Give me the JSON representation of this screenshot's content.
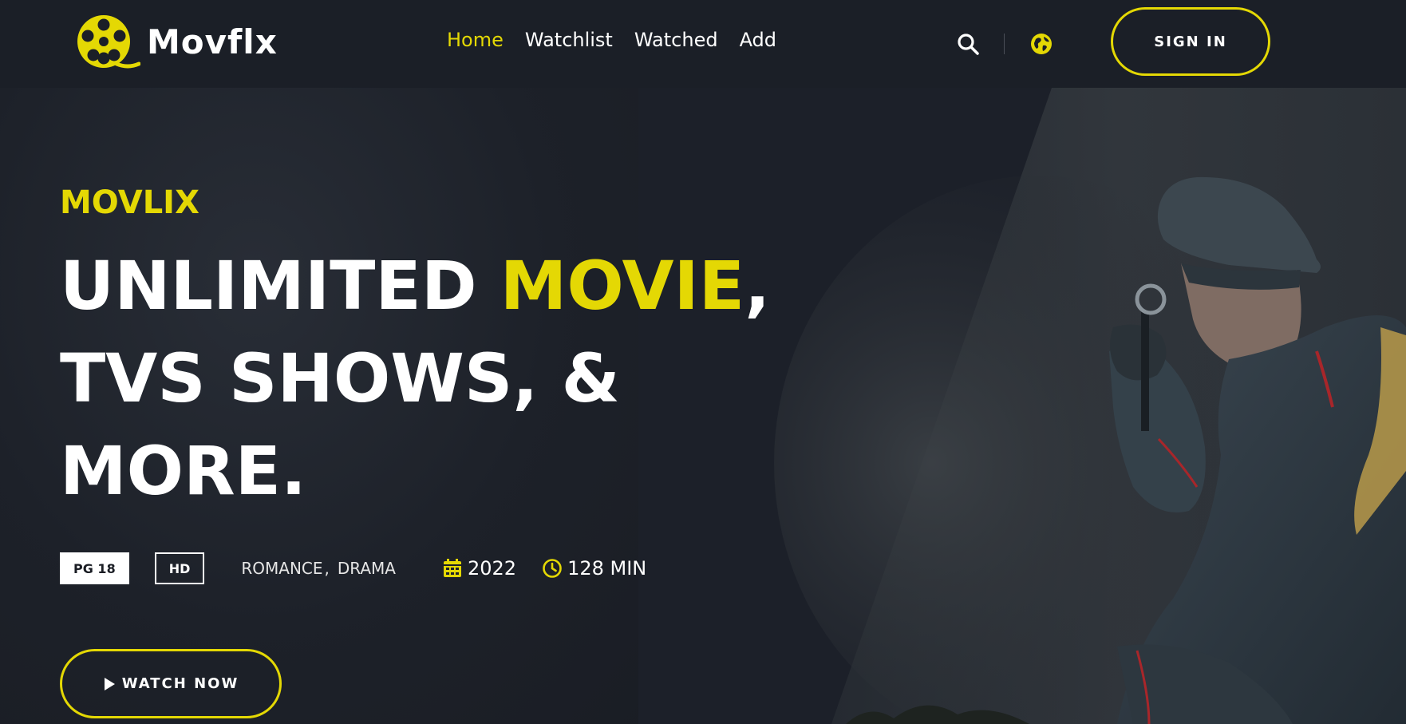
{
  "brand": {
    "name": "Movflx",
    "accent_color": "#e4d804",
    "logo_icon": "film-reel-icon"
  },
  "nav": {
    "items": [
      {
        "label": "Home",
        "active": true
      },
      {
        "label": "Watchlist",
        "active": false
      },
      {
        "label": "Watched",
        "active": false
      },
      {
        "label": "Add",
        "active": false
      }
    ],
    "search_icon": "search-icon",
    "language_icon": "globe-icon",
    "signin_label": "SIGN IN"
  },
  "hero": {
    "subtitle": "MOVLIX",
    "headline": {
      "part1": "UNLIMITED ",
      "accent": "MOVIE",
      "part2": ",",
      "line2": "TVS SHOWS, &",
      "line3": "MORE."
    },
    "rating": "PG 18",
    "quality": "HD",
    "genres": [
      "ROMANCE",
      "DRAMA"
    ],
    "genre_separator": ",",
    "year": "2022",
    "duration": "128 MIN",
    "watch_label": "WATCH NOW"
  }
}
